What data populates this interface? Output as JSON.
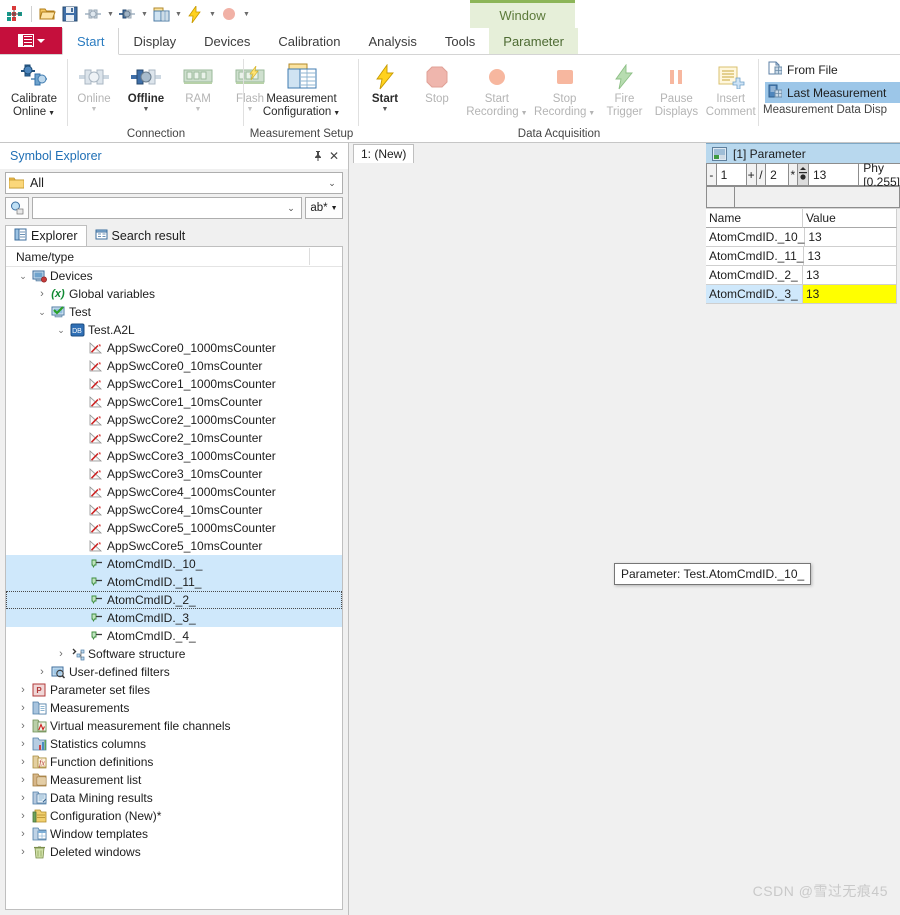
{
  "quick_access": {
    "items": [
      {
        "name": "app-logo-icon",
        "label": "CANape"
      },
      {
        "name": "open-icon",
        "label": "Open"
      },
      {
        "name": "save-icon",
        "label": "Save"
      },
      {
        "name": "online-connect-icon",
        "label": "Go Online"
      },
      {
        "name": "offline-connect-icon",
        "label": "Go Offline"
      },
      {
        "name": "measurement-config-icon",
        "label": "Measurement Configuration"
      },
      {
        "name": "start-measurement-icon",
        "label": "Start Measurement"
      },
      {
        "name": "stop-measurement-icon",
        "label": "Stop Measurement"
      },
      {
        "name": "customize-qat-icon",
        "label": "Customize Quick Access Toolbar"
      }
    ]
  },
  "ribbon": {
    "app_button_label": "File",
    "contextual_group": "Window",
    "tabs": [
      {
        "label": "Start",
        "state": "active"
      },
      {
        "label": "Display",
        "state": "normal"
      },
      {
        "label": "Devices",
        "state": "normal"
      },
      {
        "label": "Calibration",
        "state": "normal"
      },
      {
        "label": "Analysis",
        "state": "normal"
      },
      {
        "label": "Tools",
        "state": "normal"
      },
      {
        "label": "Parameter",
        "state": "contextual"
      }
    ],
    "groups": [
      {
        "title": "",
        "buttons": [
          {
            "label_top": "Calibrate",
            "label_bottom": "Online",
            "icon": "calibrate-online-icon",
            "enabled": true,
            "dropdown": true
          }
        ]
      },
      {
        "title": "Connection",
        "buttons": [
          {
            "label_top": "Online",
            "label_bottom": "",
            "icon": "online-icon",
            "enabled": false,
            "dropdown": true
          },
          {
            "label_top": "Offline",
            "label_bottom": "",
            "icon": "offline-icon",
            "enabled": true,
            "dropdown": true
          },
          {
            "label_top": "RAM",
            "label_bottom": "",
            "icon": "ram-icon",
            "enabled": false,
            "dropdown": true
          },
          {
            "label_top": "Flash",
            "label_bottom": "",
            "icon": "flash-icon",
            "enabled": false,
            "dropdown": true
          }
        ]
      },
      {
        "title": "Measurement Setup",
        "buttons": [
          {
            "label_top": "Measurement",
            "label_bottom": "Configuration",
            "icon": "measurement-configuration-icon",
            "enabled": true,
            "dropdown": true
          }
        ]
      },
      {
        "title": "Data Acquisition",
        "buttons": [
          {
            "label_top": "Start",
            "label_bottom": "",
            "icon": "start-icon",
            "enabled": true,
            "dropdown": true
          },
          {
            "label_top": "Stop",
            "label_bottom": "",
            "icon": "stop-icon",
            "enabled": false,
            "dropdown": false
          },
          {
            "label_top": "Start",
            "label_bottom": "Recording",
            "icon": "start-recording-icon",
            "enabled": false,
            "dropdown": true
          },
          {
            "label_top": "Stop",
            "label_bottom": "Recording",
            "icon": "stop-recording-icon",
            "enabled": false,
            "dropdown": true
          },
          {
            "label_top": "Fire",
            "label_bottom": "Trigger",
            "icon": "fire-trigger-icon",
            "enabled": false,
            "dropdown": false
          },
          {
            "label_top": "Pause",
            "label_bottom": "Displays",
            "icon": "pause-displays-icon",
            "enabled": false,
            "dropdown": false
          },
          {
            "label_top": "Insert",
            "label_bottom": "Comment",
            "icon": "insert-comment-icon",
            "enabled": false,
            "dropdown": false
          }
        ]
      },
      {
        "title": "Measurement Data Disp",
        "menu_items": [
          {
            "label": "From File",
            "icon": "from-file-icon",
            "selected": false
          },
          {
            "label": "Last Measurement",
            "icon": "last-measurement-icon",
            "selected": true
          }
        ]
      }
    ]
  },
  "symbol_explorer": {
    "title": "Symbol Explorer",
    "pin_icon": "pin-icon",
    "close_icon": "close-icon",
    "filter_combo": {
      "value": "All",
      "icon": "folder-icon"
    },
    "search": {
      "value": "",
      "placeholder": "",
      "button_icon": "search-icon",
      "mode_label": "ab*"
    },
    "tabs": [
      {
        "label": "Explorer",
        "icon": "explorer-icon",
        "active": true
      },
      {
        "label": "Search result",
        "icon": "search-result-icon",
        "active": false
      }
    ],
    "tree_header": "Name/type",
    "tree": [
      {
        "label": "Devices",
        "depth": 0,
        "expander": "open",
        "icon": "devices-icon",
        "state": "normal"
      },
      {
        "label": "Global variables",
        "depth": 1,
        "expander": "closed",
        "icon": "global-variables-icon",
        "state": "normal"
      },
      {
        "label": "Test",
        "depth": 1,
        "expander": "open",
        "icon": "device-icon",
        "state": "normal"
      },
      {
        "label": "Test.A2L",
        "depth": 2,
        "expander": "open",
        "icon": "database-icon",
        "state": "normal"
      },
      {
        "label": "AppSwcCore0_1000msCounter",
        "depth": 3,
        "expander": "none",
        "icon": "measurement-icon",
        "state": "normal"
      },
      {
        "label": "AppSwcCore0_10msCounter",
        "depth": 3,
        "expander": "none",
        "icon": "measurement-icon",
        "state": "normal"
      },
      {
        "label": "AppSwcCore1_1000msCounter",
        "depth": 3,
        "expander": "none",
        "icon": "measurement-icon",
        "state": "normal"
      },
      {
        "label": "AppSwcCore1_10msCounter",
        "depth": 3,
        "expander": "none",
        "icon": "measurement-icon",
        "state": "normal"
      },
      {
        "label": "AppSwcCore2_1000msCounter",
        "depth": 3,
        "expander": "none",
        "icon": "measurement-icon",
        "state": "normal"
      },
      {
        "label": "AppSwcCore2_10msCounter",
        "depth": 3,
        "expander": "none",
        "icon": "measurement-icon",
        "state": "normal"
      },
      {
        "label": "AppSwcCore3_1000msCounter",
        "depth": 3,
        "expander": "none",
        "icon": "measurement-icon",
        "state": "normal"
      },
      {
        "label": "AppSwcCore3_10msCounter",
        "depth": 3,
        "expander": "none",
        "icon": "measurement-icon",
        "state": "normal"
      },
      {
        "label": "AppSwcCore4_1000msCounter",
        "depth": 3,
        "expander": "none",
        "icon": "measurement-icon",
        "state": "normal"
      },
      {
        "label": "AppSwcCore4_10msCounter",
        "depth": 3,
        "expander": "none",
        "icon": "measurement-icon",
        "state": "normal"
      },
      {
        "label": "AppSwcCore5_1000msCounter",
        "depth": 3,
        "expander": "none",
        "icon": "measurement-icon",
        "state": "normal"
      },
      {
        "label": "AppSwcCore5_10msCounter",
        "depth": 3,
        "expander": "none",
        "icon": "measurement-icon",
        "state": "normal"
      },
      {
        "label": "AtomCmdID._10_",
        "depth": 3,
        "expander": "none",
        "icon": "parameter-icon",
        "state": "selected"
      },
      {
        "label": "AtomCmdID._11_",
        "depth": 3,
        "expander": "none",
        "icon": "parameter-icon",
        "state": "selected"
      },
      {
        "label": "AtomCmdID._2_",
        "depth": 3,
        "expander": "none",
        "icon": "parameter-icon",
        "state": "focused"
      },
      {
        "label": "AtomCmdID._3_",
        "depth": 3,
        "expander": "none",
        "icon": "parameter-icon",
        "state": "selected"
      },
      {
        "label": "AtomCmdID._4_",
        "depth": 3,
        "expander": "none",
        "icon": "parameter-icon",
        "state": "normal"
      },
      {
        "label": "Software structure",
        "depth": 2,
        "expander": "closed",
        "icon": "software-structure-icon",
        "state": "normal"
      },
      {
        "label": "User-defined filters",
        "depth": 1,
        "expander": "closed",
        "icon": "user-filter-icon",
        "state": "normal"
      },
      {
        "label": "Parameter set files",
        "depth": 0,
        "expander": "closed",
        "icon": "parameter-set-files-icon",
        "state": "normal"
      },
      {
        "label": "Measurements",
        "depth": 0,
        "expander": "closed",
        "icon": "measurements-icon",
        "state": "normal"
      },
      {
        "label": "Virtual measurement file channels",
        "depth": 0,
        "expander": "closed",
        "icon": "virtual-channels-icon",
        "state": "normal"
      },
      {
        "label": "Statistics columns",
        "depth": 0,
        "expander": "closed",
        "icon": "statistics-columns-icon",
        "state": "normal"
      },
      {
        "label": "Function definitions",
        "depth": 0,
        "expander": "closed",
        "icon": "function-definitions-icon",
        "state": "normal"
      },
      {
        "label": "Measurement list",
        "depth": 0,
        "expander": "closed",
        "icon": "measurement-list-icon",
        "state": "normal"
      },
      {
        "label": "Data Mining results",
        "depth": 0,
        "expander": "closed",
        "icon": "data-mining-icon",
        "state": "normal"
      },
      {
        "label": "Configuration (New)*",
        "depth": 0,
        "expander": "closed",
        "icon": "configuration-icon",
        "state": "normal"
      },
      {
        "label": "Window templates",
        "depth": 0,
        "expander": "closed",
        "icon": "window-templates-icon",
        "state": "normal"
      },
      {
        "label": "Deleted windows",
        "depth": 0,
        "expander": "closed",
        "icon": "deleted-windows-icon",
        "state": "normal"
      }
    ]
  },
  "document": {
    "tab_label": "1: (New)"
  },
  "parameter_window": {
    "title": "[1] Parameter",
    "title_icon": "parameter-window-icon",
    "toolbar": {
      "minus_label": "-",
      "step_down_value": "1",
      "plus_label": "+",
      "divide_label": "/",
      "factor_value": "2",
      "multiply_label": "*",
      "updown_icon": "spin-updown-icon",
      "current_value": "13",
      "unit_label": "Phy [0,255]"
    },
    "grid": {
      "columns": [
        "Name",
        "Value"
      ],
      "rows": [
        {
          "name": "AtomCmdID._10_",
          "value": "13",
          "selected": false
        },
        {
          "name": "AtomCmdID._11_",
          "value": "13",
          "selected": false
        },
        {
          "name": "AtomCmdID._2_",
          "value": "13",
          "selected": false
        },
        {
          "name": "AtomCmdID._3_",
          "value": "13",
          "selected": true
        }
      ]
    }
  },
  "tooltip": {
    "text": "Parameter: Test.AtomCmdID._10_"
  },
  "watermark": {
    "text": "CSDN @雪过无痕45"
  },
  "colors": {
    "app_button_red": "#c50f3c",
    "active_tab_blue": "#2b7cc0",
    "contextual_green": "#e6efd9",
    "contextual_green_border": "#8cb558",
    "selection_blue": "#cfe8fb",
    "param_header_blue": "#b8d8ee",
    "value_highlight_yellow": "#ffff00"
  }
}
